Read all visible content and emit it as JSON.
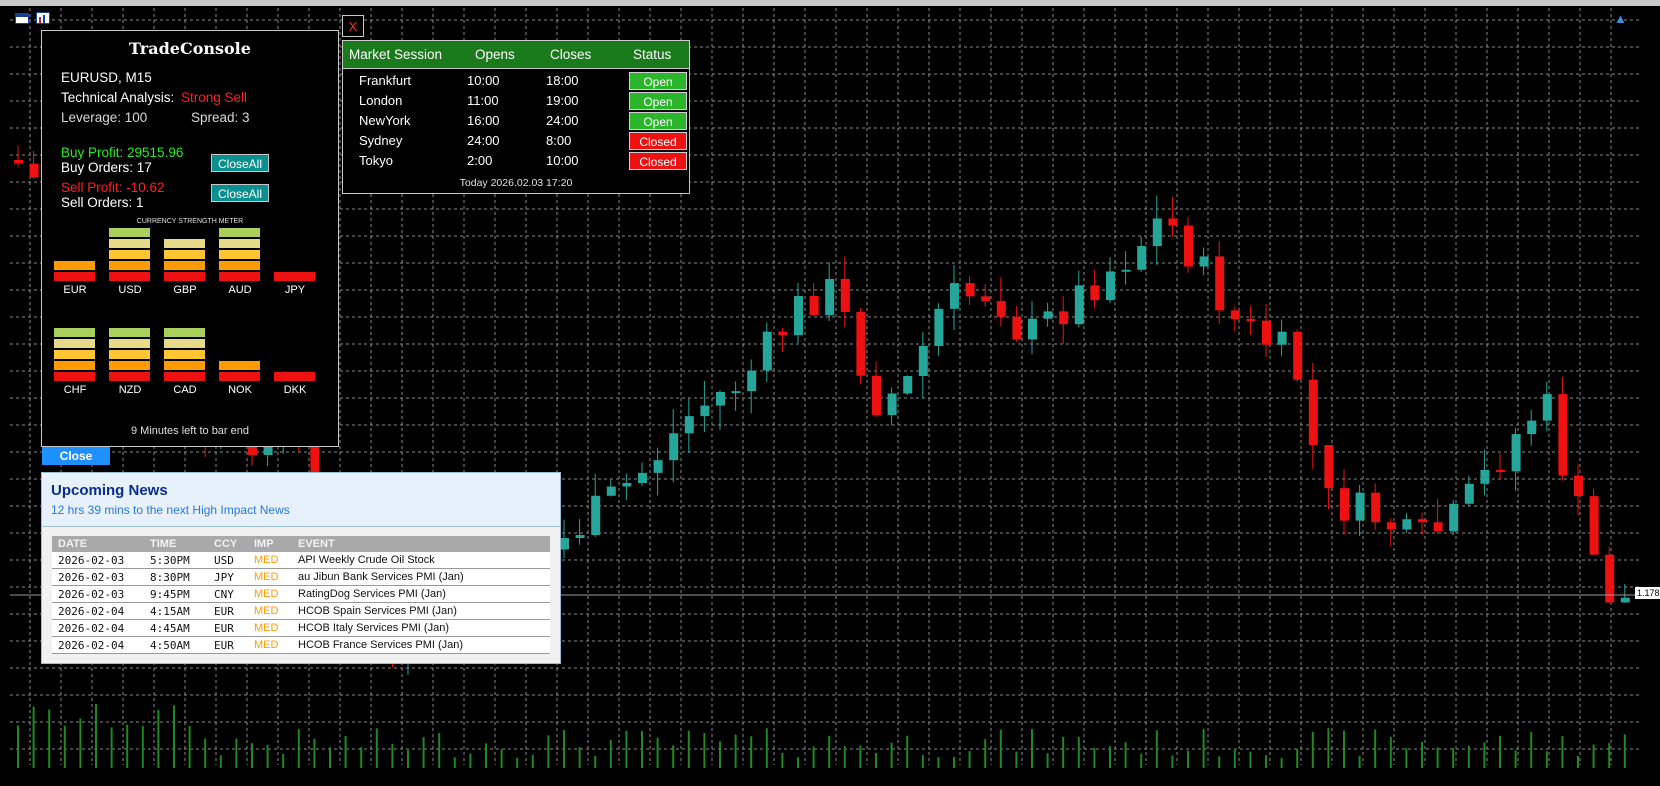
{
  "toolbar": {
    "left_icons": [
      "calendar-grid-icon",
      "calendar-chart-icon"
    ],
    "right_icon": "graduation-cap-icon"
  },
  "trade_console": {
    "title": "TradeConsole",
    "symbol": "EURUSD,  M15",
    "ta_label": "Technical Analysis:",
    "ta_value": "Strong Sell",
    "leverage": "Leverage: 100",
    "spread": "Spread: 3",
    "buy_profit": "Buy Profit: 29515.96",
    "buy_orders": "Buy Orders: 17",
    "sell_profit": "Sell Profit: -10.62",
    "sell_orders": "Sell Orders: 1",
    "close_all_label": "CloseAll",
    "meter_title": "CURRENCY STRENGTH METER",
    "currencies": [
      {
        "code": "EUR",
        "level": 2
      },
      {
        "code": "USD",
        "level": 5
      },
      {
        "code": "GBP",
        "level": 4
      },
      {
        "code": "AUD",
        "level": 5
      },
      {
        "code": "JPY",
        "level": 1
      },
      {
        "code": "CHF",
        "level": 5
      },
      {
        "code": "NZD",
        "level": 5
      },
      {
        "code": "CAD",
        "level": 5
      },
      {
        "code": "NOK",
        "level": 2
      },
      {
        "code": "DKK",
        "level": 1
      }
    ],
    "bar_colors": [
      "#ee1111",
      "#ff9a00",
      "#ffc533",
      "#e6d98a",
      "#a9cf5c"
    ],
    "bar_end_text": "9 Minutes left to bar end"
  },
  "x_button": {
    "label": "X"
  },
  "market_session": {
    "headers": [
      "Market Session",
      "Opens",
      "Closes",
      "Status"
    ],
    "rows": [
      {
        "name": "Frankfurt",
        "opens": "10:00",
        "closes": "18:00",
        "status": "Open",
        "color": "#2ab52a"
      },
      {
        "name": "London",
        "opens": "11:00",
        "closes": "19:00",
        "status": "Open",
        "color": "#2ab52a"
      },
      {
        "name": "NewYork",
        "opens": "16:00",
        "closes": "24:00",
        "status": "Open",
        "color": "#2ab52a"
      },
      {
        "name": "Sydney",
        "opens": "24:00",
        "closes": "8:00",
        "status": "Closed",
        "color": "#ee1111"
      },
      {
        "name": "Tokyo",
        "opens": "2:00",
        "closes": "10:00",
        "status": "Closed",
        "color": "#ee1111"
      }
    ],
    "footer": "Today 2026.02.03 17:20"
  },
  "close_button": {
    "label": "Close"
  },
  "news": {
    "title": "Upcoming News",
    "subtitle": "12 hrs 39 mins to the next High Impact News",
    "headers": [
      "DATE",
      "TIME",
      "CCY",
      "IMP",
      "EVENT"
    ],
    "rows": [
      [
        "2026-02-03",
        "5:30PM",
        "USD",
        "MED",
        "API Weekly Crude Oil Stock"
      ],
      [
        "2026-02-03",
        "8:30PM",
        "JPY",
        "MED",
        "au Jibun Bank Services PMI (Jan)"
      ],
      [
        "2026-02-03",
        "9:45PM",
        "CNY",
        "MED",
        "RatingDog Services PMI (Jan)"
      ],
      [
        "2026-02-04",
        "4:15AM",
        "EUR",
        "MED",
        "HCOB Spain Services PMI (Jan)"
      ],
      [
        "2026-02-04",
        "4:45AM",
        "EUR",
        "MED",
        "HCOB Italy Services PMI (Jan)"
      ],
      [
        "2026-02-04",
        "4:50AM",
        "EUR",
        "MED",
        "HCOB France Services PMI (Jan)"
      ]
    ]
  },
  "price_label": "1.178",
  "colors": {
    "bull": "#26a69a",
    "bear": "#ee1111",
    "grid": "#8a8a8a",
    "volume": "#1f8a1f",
    "med": "#ff9a00"
  }
}
